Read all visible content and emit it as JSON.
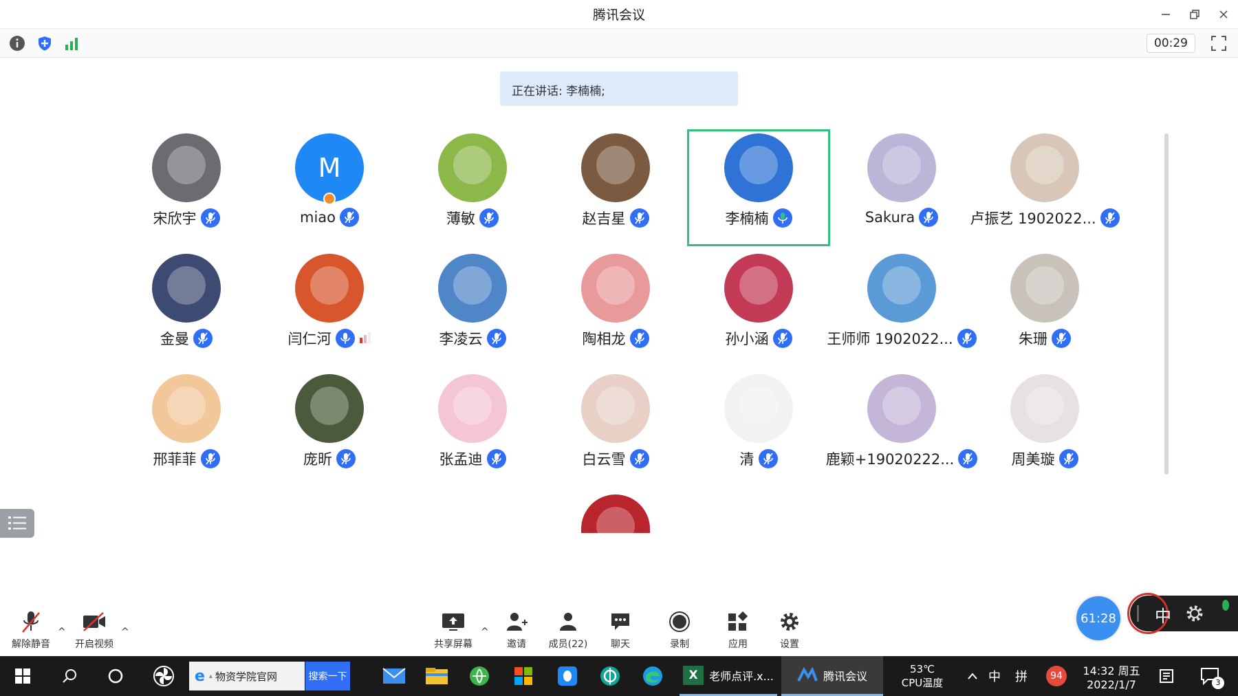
{
  "window": {
    "title": "腾讯会议"
  },
  "statusbar": {
    "timer": "00:29"
  },
  "speaking": {
    "label": "正在讲话: 李楠楠;"
  },
  "participants": [
    {
      "name": "宋欣宇",
      "avatar_color": "#6e6a72",
      "mic": "muted"
    },
    {
      "name": "miao",
      "avatar_text": "M",
      "avatar_color": "#1e88f5",
      "mic": "muted",
      "host": true
    },
    {
      "name": "薄敏",
      "avatar_color": "#8cb84a",
      "mic": "muted"
    },
    {
      "name": "赵吉星",
      "avatar_color": "#7a5a40",
      "mic": "muted"
    },
    {
      "name": "李楠楠",
      "avatar_color": "#2f73d6",
      "mic": "speaking",
      "active": true
    },
    {
      "name": "Sakura",
      "avatar_color": "#b9b6d8",
      "mic": "muted"
    },
    {
      "name": "卢振艺 1902022...",
      "avatar_color": "#d8c6b8",
      "mic": "muted"
    },
    {
      "name": "金曼",
      "avatar_color": "#3d4a72",
      "mic": "muted"
    },
    {
      "name": "闫仁河",
      "avatar_color": "#d7562c",
      "mic": "on"
    },
    {
      "name": "李凌云",
      "avatar_color": "#4f86c8",
      "mic": "muted"
    },
    {
      "name": "陶相龙",
      "avatar_color": "#e89a9a",
      "mic": "muted"
    },
    {
      "name": "孙小涵",
      "avatar_color": "#c23a55",
      "mic": "muted"
    },
    {
      "name": "王师师 1902022...",
      "avatar_color": "#5a9ad6",
      "mic": "muted"
    },
    {
      "name": "朱珊",
      "avatar_color": "#c8c2bb",
      "mic": "muted"
    },
    {
      "name": "邢菲菲",
      "avatar_color": "#f2c79a",
      "mic": "muted"
    },
    {
      "name": "庞昕",
      "avatar_color": "#4a5a3a",
      "mic": "muted"
    },
    {
      "name": "张孟迪",
      "avatar_color": "#f4c6d4",
      "mic": "muted"
    },
    {
      "name": "白云雪",
      "avatar_color": "#e8d0c6",
      "mic": "muted"
    },
    {
      "name": "清",
      "avatar_color": "#f2f2f2",
      "mic": "muted"
    },
    {
      "name": "鹿颖+19020222...",
      "avatar_color": "#c4b6d6",
      "mic": "muted"
    },
    {
      "name": "周美璇",
      "avatar_color": "#e7e1e1",
      "mic": "muted"
    },
    {
      "name": "",
      "avatar_color": "#b8252c",
      "mic": "none"
    }
  ],
  "toolbar": {
    "unmute": "解除静音",
    "video": "开启视频",
    "share": "共享屏幕",
    "invite": "邀请",
    "members": "成员(22)",
    "chat": "聊天",
    "record": "录制",
    "apps": "应用",
    "settings": "设置"
  },
  "float": {
    "timer": "61:28",
    "ime": "中"
  },
  "taskbar": {
    "browser_tab": "物资学院官网",
    "search_btn": "搜索一下",
    "excel": "老师点评.x...",
    "meeting": "腾讯会议",
    "temp": "53℃",
    "temp_label": "CPU温度",
    "ime1": "中",
    "ime2": "拼",
    "badge": "94",
    "time": "14:32 周五",
    "date": "2022/1/7",
    "notif_count": "3"
  }
}
